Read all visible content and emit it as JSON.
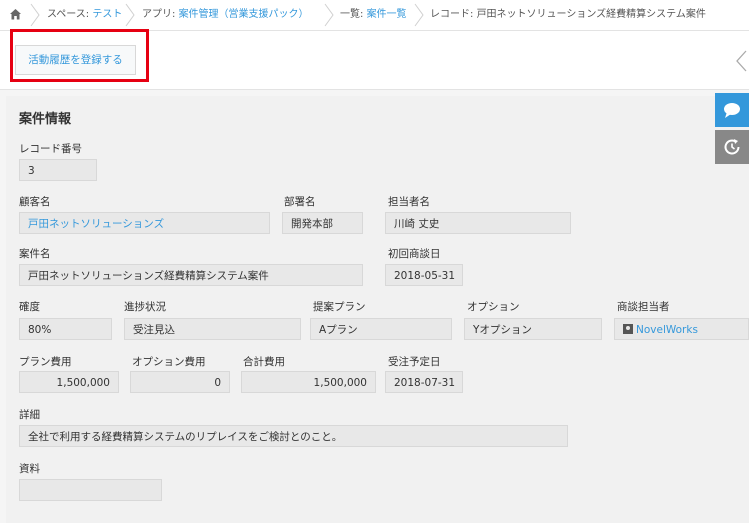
{
  "breadcrumb": {
    "space_prefix": "スペース: ",
    "space_link": "テスト",
    "app_prefix": "アプリ: ",
    "app_link": "案件管理（営業支援パック）",
    "list_prefix": "一覧: ",
    "list_link": "案件一覧",
    "record_prefix": "レコード: ",
    "record_name": "戸田ネットソリューションズ経費精算システム案件"
  },
  "action": {
    "label": "活動履歴を登録する"
  },
  "section": {
    "title": "案件情報"
  },
  "fields": {
    "record_no": {
      "label": "レコード番号",
      "value": "3"
    },
    "customer": {
      "label": "顧客名",
      "value": "戸田ネットソリューションズ"
    },
    "department": {
      "label": "部署名",
      "value": "開発本部"
    },
    "contact": {
      "label": "担当者名",
      "value": "川崎 丈史"
    },
    "project": {
      "label": "案件名",
      "value": "戸田ネットソリューションズ経費精算システム案件"
    },
    "first_meeting": {
      "label": "初回商談日",
      "value": "2018-05-31"
    },
    "certainty": {
      "label": "確度",
      "value": "80%"
    },
    "progress": {
      "label": "進捗状況",
      "value": "受注見込"
    },
    "plan": {
      "label": "提案プラン",
      "value": "Aプラン"
    },
    "option": {
      "label": "オプション",
      "value": "Yオプション"
    },
    "sales_rep": {
      "label": "商談担当者",
      "value": "NovelWorks"
    },
    "plan_cost": {
      "label": "プラン費用",
      "value": "1,500,000"
    },
    "option_cost": {
      "label": "オプション費用",
      "value": "0"
    },
    "total_cost": {
      "label": "合計費用",
      "value": "1,500,000"
    },
    "order_date": {
      "label": "受注予定日",
      "value": "2018-07-31"
    },
    "details": {
      "label": "詳細",
      "value": "全社で利用する経費精算システムのリプレイスをご検討とのこと。"
    },
    "materials": {
      "label": "資料",
      "value": ""
    }
  },
  "colors": {
    "accent": "#3498db",
    "highlight": "#e60012"
  },
  "icons": {
    "home": "home-icon",
    "comment": "comment-icon",
    "history": "history-icon"
  }
}
